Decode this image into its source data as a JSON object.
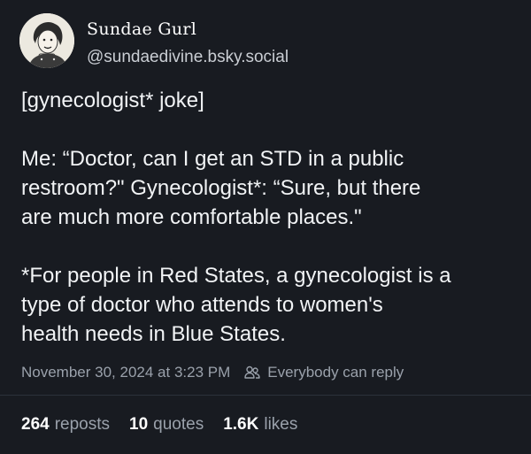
{
  "author": {
    "display_name": "Sundae Gurl",
    "handle": "@sundaedivine.bsky.social",
    "avatar_icon": "vintage-woman-avatar-icon"
  },
  "post": {
    "line1": "[gynecologist* joke]",
    "line2": "Me: “Doctor, can I get an STD in a public",
    "line3": "restroom?\"  Gynecologist*:  “Sure, but there",
    "line4": "are much more comfortable places.\"",
    "line5": "*For people in Red States, a gynecologist is a",
    "line6": "type of doctor who attends to women's",
    "line7": "health needs in Blue States."
  },
  "meta": {
    "timestamp": "November 30, 2024 at 3:23 PM",
    "reply_setting_icon": "people-icon",
    "reply_setting": "Everybody can reply"
  },
  "stats": {
    "reposts_count": "264",
    "reposts_label": "reposts",
    "quotes_count": "10",
    "quotes_label": "quotes",
    "likes_count": "1.6K",
    "likes_label": "likes"
  },
  "colors": {
    "background": "#181b21",
    "text": "#f1f3f5",
    "muted": "#9aa1ab"
  }
}
